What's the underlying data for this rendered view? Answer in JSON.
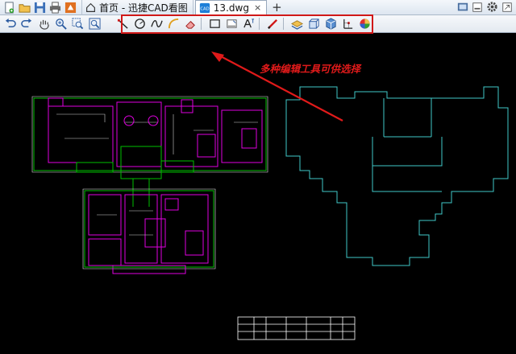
{
  "tabs": {
    "home_label": "首页 - 迅捷CAD看图",
    "doc_label": "13.dwg",
    "close_glyph": "×",
    "add_glyph": "+"
  },
  "callout": {
    "text": "多种编辑工具可供选择"
  },
  "drawing_table": {
    "rows": [
      [
        "",
        "",
        "",
        "",
        "",
        "",
        ""
      ],
      [
        "",
        "",
        "",
        "",
        "",
        "",
        ""
      ],
      [
        "",
        "",
        "",
        "",
        "",
        "",
        ""
      ]
    ]
  },
  "colors": {
    "highlight": "#d01818",
    "cad_background": "#000000",
    "plan_magenta": "#e000e0",
    "plan_green": "#00d000",
    "plan_cyan": "#40c8c8",
    "plan_white": "#ffffff"
  },
  "icons": {
    "quick": [
      "new-file-icon",
      "open-icon",
      "save-icon",
      "print-icon",
      "home-icon"
    ],
    "toolbar": [
      "undo-icon",
      "redo-icon",
      "pan-icon",
      "zoom-in-icon",
      "zoom-window-icon",
      "zoom-extents-icon",
      "line-icon",
      "circle-icon",
      "spline-icon",
      "arc-icon",
      "eraser-icon",
      "rectangle-icon",
      "revision-cloud-icon",
      "text-icon",
      "measure-icon",
      "layer-icon",
      "block-icon",
      "3d-box-icon",
      "coordinate-icon",
      "color-wheel-icon"
    ],
    "right": [
      "fullscreen-icon",
      "minimize-view-icon",
      "settings-icon",
      "restore-icon"
    ]
  }
}
